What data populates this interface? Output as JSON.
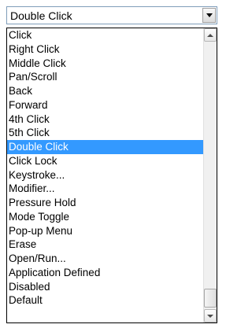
{
  "combo": {
    "value": "Double Click"
  },
  "list": {
    "selected_index": 9,
    "items": [
      "Click",
      "Right Click",
      "Middle Click",
      "Pan/Scroll",
      "Back",
      "Forward",
      "4th Click",
      "5th Click",
      "Double Click",
      "Click Lock",
      "Keystroke...",
      "Modifier...",
      "Pressure Hold",
      "Mode Toggle",
      "Pop-up Menu",
      "Erase",
      "Open/Run...",
      "Application Defined",
      "Disabled",
      "Default"
    ]
  },
  "scrollbar": {
    "position_fraction": 1.0
  },
  "colors": {
    "selection": "#3399ff",
    "selection_text": "#ffffff",
    "combo_border": "#7f9db9"
  },
  "icons": {
    "dropdown": "chevron-down-icon",
    "scroll_up": "scroll-up-arrow-icon",
    "scroll_down": "scroll-down-arrow-icon"
  }
}
